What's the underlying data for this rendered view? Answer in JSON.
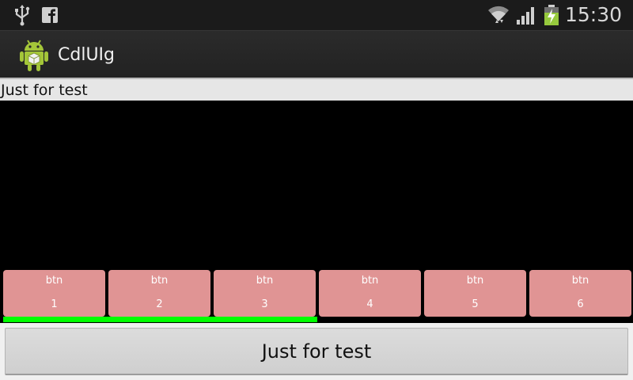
{
  "status_bar": {
    "time": "15:30",
    "icons": [
      "usb-icon",
      "facebook-icon",
      "wifi-icon",
      "signal-icon",
      "battery-charging-icon"
    ]
  },
  "action_bar": {
    "title": "CdlUIg",
    "icon": "android-app-icon"
  },
  "text_strip": {
    "text": "Just for test"
  },
  "buttons": [
    {
      "line1": "btn",
      "line2": "1"
    },
    {
      "line1": "btn",
      "line2": "2"
    },
    {
      "line1": "btn",
      "line2": "3"
    },
    {
      "line1": "btn",
      "line2": "4"
    },
    {
      "line1": "btn",
      "line2": "5"
    },
    {
      "line1": "btn",
      "line2": "6"
    }
  ],
  "progress": {
    "value": 0.5
  },
  "bottom_button": {
    "label": "Just for test"
  },
  "colors": {
    "button_fill": "#e09494",
    "progress_fill": "#00ff00",
    "status_bar": "#1b1b1b",
    "action_bar": "#262626"
  }
}
